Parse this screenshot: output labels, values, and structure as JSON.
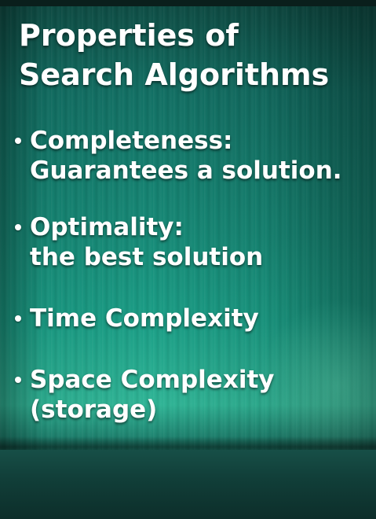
{
  "slide": {
    "title_line1": "Properties of",
    "title_line2": "Search Algorithms",
    "bullets": [
      {
        "line1": "Completeness:",
        "line2": "Guarantees a solution."
      },
      {
        "line1": "Optimality:",
        "line2": "the best solution"
      },
      {
        "line1": "Time Complexity"
      },
      {
        "line1": "Space Complexity",
        "line2": "(storage)"
      }
    ]
  }
}
